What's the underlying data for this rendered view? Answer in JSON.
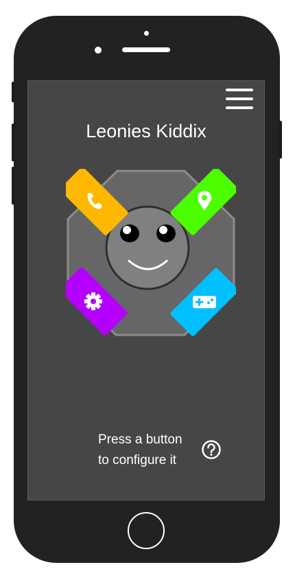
{
  "app": {
    "title": "Leonies Kiddix"
  },
  "buttons": [
    {
      "id": "phone",
      "icon": "phone-icon",
      "color": "#FFB800"
    },
    {
      "id": "location",
      "icon": "location-pin-icon",
      "color": "#4CFF00"
    },
    {
      "id": "settings",
      "icon": "gear-icon",
      "color": "#B400FF"
    },
    {
      "id": "games",
      "icon": "gamepad-icon",
      "color": "#00C0FF"
    }
  ],
  "hint": {
    "line1": "Press a button",
    "line2": "to configure it"
  },
  "colors": {
    "phone_body": "#222222",
    "screen": "#464646",
    "device_body": "#666666",
    "face": "#808080"
  }
}
